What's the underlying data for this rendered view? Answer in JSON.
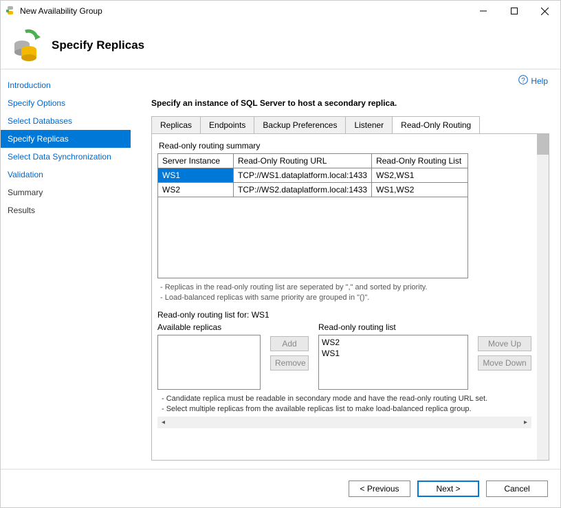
{
  "window": {
    "title": "New Availability Group"
  },
  "header": {
    "title": "Specify Replicas"
  },
  "help": {
    "label": "Help"
  },
  "sidebar": {
    "items": [
      {
        "label": "Introduction"
      },
      {
        "label": "Specify Options"
      },
      {
        "label": "Select Databases"
      },
      {
        "label": "Specify Replicas"
      },
      {
        "label": "Select Data Synchronization"
      },
      {
        "label": "Validation"
      },
      {
        "label": "Summary"
      },
      {
        "label": "Results"
      }
    ]
  },
  "main": {
    "instruction": "Specify an instance of SQL Server to host a secondary replica.",
    "tabs": [
      {
        "label": "Replicas"
      },
      {
        "label": "Endpoints"
      },
      {
        "label": "Backup Preferences"
      },
      {
        "label": "Listener"
      },
      {
        "label": "Read-Only Routing"
      }
    ],
    "summary": {
      "group_label": "Read-only routing summary",
      "columns": {
        "c0": "Server Instance",
        "c1": "Read-Only Routing URL",
        "c2": "Read-Only Routing List"
      },
      "rows": [
        {
          "instance": "WS1",
          "url": "TCP://WS1.dataplatform.local:1433",
          "list": "WS2,WS1"
        },
        {
          "instance": "WS2",
          "url": "TCP://WS2.dataplatform.local:1433",
          "list": "WS1,WS2"
        }
      ],
      "hint1": "- Replicas in the read-only routing list are seperated by \",\" and sorted by priority.",
      "hint2": "- Load-balanced replicas with same priority are grouped in \"()\"."
    },
    "routing": {
      "list_for_label": "Read-only routing list for: WS1",
      "available_label": "Available replicas",
      "routing_list_label": "Read-only routing list",
      "available": [],
      "routing_list": [
        "WS2",
        "WS1"
      ],
      "add_label": "Add",
      "remove_label": "Remove",
      "moveup_label": "Move Up",
      "movedown_label": "Move Down",
      "hintA": "- Candidate replica must be readable in secondary mode and have the read-only routing URL set.",
      "hintB": "- Select multiple replicas from the available replicas list to make load-balanced replica group."
    }
  },
  "footer": {
    "previous": "< Previous",
    "next": "Next >",
    "cancel": "Cancel"
  }
}
